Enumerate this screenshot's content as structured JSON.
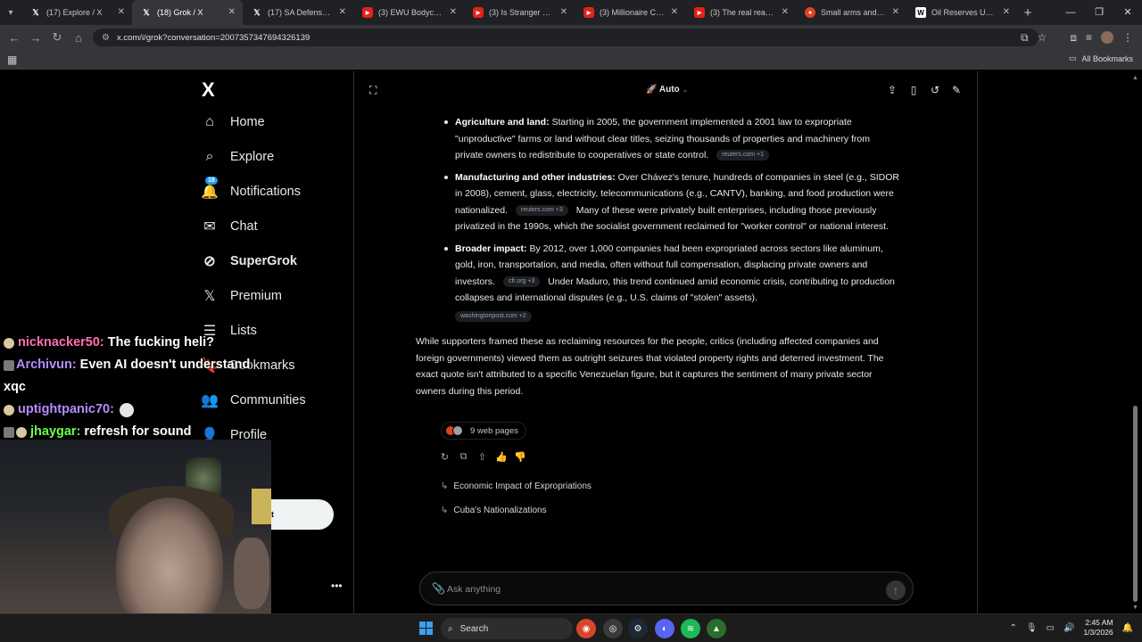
{
  "browser": {
    "tabs": [
      {
        "title": "(17) Explore / X",
        "favicon": "x"
      },
      {
        "title": "(18) Grok / X",
        "favicon": "x",
        "active": true
      },
      {
        "title": "(17) SA Defensa (@S",
        "favicon": "x"
      },
      {
        "title": "(3) EWU Bodycam - Y",
        "favicon": "yt"
      },
      {
        "title": "(3) Is Stranger Thing",
        "favicon": "yt"
      },
      {
        "title": "(3) Millionaire Charg",
        "favicon": "yt"
      },
      {
        "title": "(3) The real reason V",
        "favicon": "yt"
      },
      {
        "title": "Small arms and Helic",
        "favicon": "red"
      },
      {
        "title": "Oil Reserves Update",
        "favicon": "w"
      }
    ],
    "url": "x.com/i/grok?conversation=2007357347694326139",
    "bookmarks_label": "All Bookmarks"
  },
  "sidebar": {
    "logo": "X",
    "items": [
      {
        "label": "Home",
        "icon": "home-icon",
        "glyph": "⌂"
      },
      {
        "label": "Explore",
        "icon": "search-icon",
        "glyph": "⌕"
      },
      {
        "label": "Notifications",
        "icon": "bell-icon",
        "glyph": "🔔",
        "badge": "18"
      },
      {
        "label": "Chat",
        "icon": "mail-icon",
        "glyph": "✉"
      },
      {
        "label": "SuperGrok",
        "icon": "grok-icon",
        "glyph": "⊘",
        "bold": true
      },
      {
        "label": "Premium",
        "icon": "x-premium-icon",
        "glyph": "𝕏"
      },
      {
        "label": "Lists",
        "icon": "list-icon",
        "glyph": "☰"
      },
      {
        "label": "Bookmarks",
        "icon": "bookmark-icon",
        "glyph": "🔖"
      },
      {
        "label": "Communities",
        "icon": "people-icon",
        "glyph": "👥"
      },
      {
        "label": "Profile",
        "icon": "person-icon",
        "glyph": "👤"
      }
    ],
    "post_button_fragment": "t",
    "more_glyph": "•••"
  },
  "stream_chat": [
    {
      "user": "nicknacker50:",
      "msg": "The fucking heli?"
    },
    {
      "user": "Archivun:",
      "msg": "Even AI doesn't understand"
    },
    {
      "user": "",
      "msg": "xqc"
    },
    {
      "user": "uptightpanic70:",
      "msg": ""
    },
    {
      "user": "jhaygar:",
      "msg": "refresh for sound"
    }
  ],
  "grok": {
    "model_label": "Auto",
    "bullets": [
      {
        "title": "Agriculture and land:",
        "text": "Starting in 2005, the government implemented a 2001 law to expropriate \"unproductive\" farms or land without clear titles, seizing thousands of properties and machinery from private owners to redistribute to cooperatives or state control.",
        "source": "reuters.com +1",
        "text2": ""
      },
      {
        "title": "Manufacturing and other industries:",
        "text": "Over Chávez's tenure, hundreds of companies in steel (e.g., SIDOR in 2008), cement, glass, electricity, telecommunications (e.g., CANTV), banking, and food production were nationalized.",
        "source": "reuters.com +3",
        "text2": "Many of these were privately built enterprises, including those previously privatized in the 1990s, which the socialist government reclaimed for \"worker control\" or national interest."
      },
      {
        "title": "Broader impact:",
        "text": "By 2012, over 1,000 companies had been expropriated across sectors like aluminum, gold, iron, transportation, and media, often without full compensation, displacing private owners and investors.",
        "source": "cfr.org +3",
        "text2": "Under Maduro, this trend continued amid economic crisis, contributing to production collapses and international disputes (e.g., U.S. claims of \"stolen\" assets).",
        "source2": "washingtonpost.com +2"
      }
    ],
    "paragraph": "While supporters framed these as reclaiming resources for the people, critics (including affected companies and foreign governments) viewed them as outright seizures that violated property rights and deterred investment. The exact quote isn't attributed to a specific Venezuelan figure, but it captures the sentiment of many private sector owners during this period.",
    "web_pages_label": "9 web pages",
    "related": [
      "Economic Impact of Expropriations",
      "Cuba's Nationalizations"
    ],
    "ask_placeholder": "Ask anything"
  },
  "taskbar": {
    "search_label": "Search",
    "time": "2:45 AM",
    "date": "1/3/2026"
  },
  "colors": {
    "accent": "#1d9bf0",
    "background": "#000000",
    "text": "#e7e9ea"
  }
}
